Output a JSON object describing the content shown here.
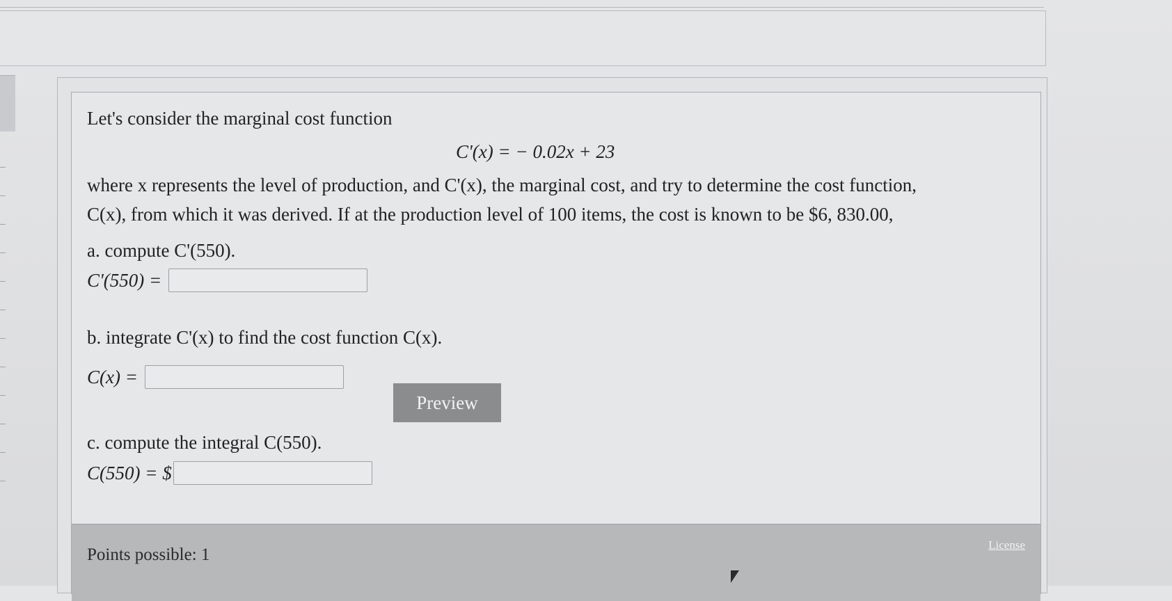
{
  "question": {
    "intro": "Let's consider the marginal cost function",
    "equation": "C'(x) = − 0.02x + 23",
    "para_line1": "where x represents the level of production, and C'(x), the marginal cost, and try to determine the cost function,",
    "para_line2": "C(x), from which it was derived. If at the production level of 100 items, the cost is known to be $6, 830.00,"
  },
  "parts": {
    "a": {
      "label": "a. compute C'(550).",
      "answer_label": "C'(550) =",
      "value": ""
    },
    "b": {
      "label": "b. integrate C'(x) to find the cost function C(x).",
      "answer_label": "C(x) =",
      "value": "",
      "preview_label": "Preview"
    },
    "c": {
      "label": "c. compute the integral C(550).",
      "answer_label": "C(550) = $",
      "value": ""
    }
  },
  "footer": {
    "points": "Points possible: 1",
    "license": "License"
  }
}
